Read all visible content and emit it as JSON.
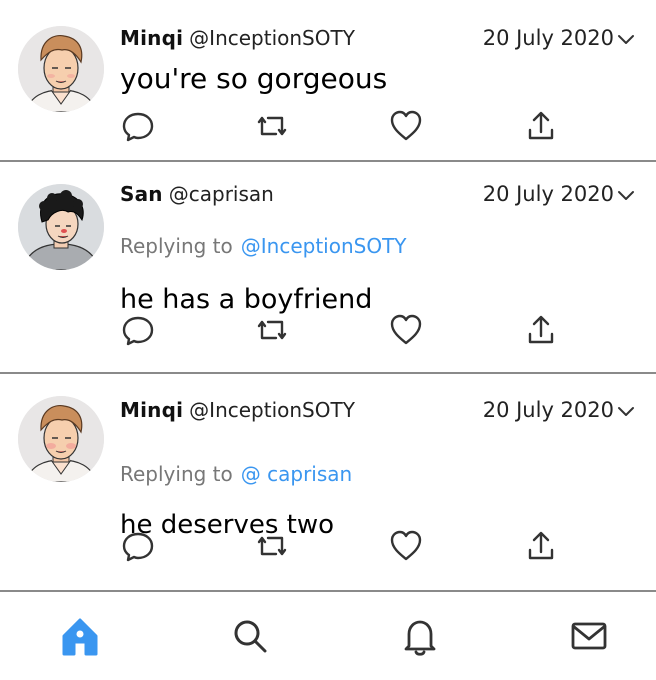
{
  "colors": {
    "accent": "#3a96f0",
    "divider": "#8a8a8a",
    "text": "#111111",
    "muted": "#777777"
  },
  "tweets": [
    {
      "author_name": "Minqi",
      "author_handle": "@InceptionSOTY",
      "date": "20 July 2020",
      "replying_to_label": "",
      "replying_to_handle": "",
      "text": "you're so gorgeous",
      "avatar": "minqi-avatar"
    },
    {
      "author_name": "San",
      "author_handle": "@caprisan",
      "date": "20 July 2020",
      "replying_to_label": "Replying to",
      "replying_to_handle": "@InceptionSOTY",
      "text": "he has a boyfriend",
      "avatar": "san-avatar"
    },
    {
      "author_name": "Minqi",
      "author_handle": "@InceptionSOTY",
      "date": "20 July 2020",
      "replying_to_label": "Replying to",
      "replying_to_handle": "@ caprisan",
      "text": "he deserves two",
      "avatar": "minqi-avatar"
    }
  ],
  "actions": [
    "reply-icon",
    "retweet-icon",
    "like-icon",
    "share-icon"
  ],
  "tabbar": {
    "active": "home",
    "items": [
      "home-icon",
      "search-icon",
      "notifications-icon",
      "messages-icon"
    ]
  }
}
